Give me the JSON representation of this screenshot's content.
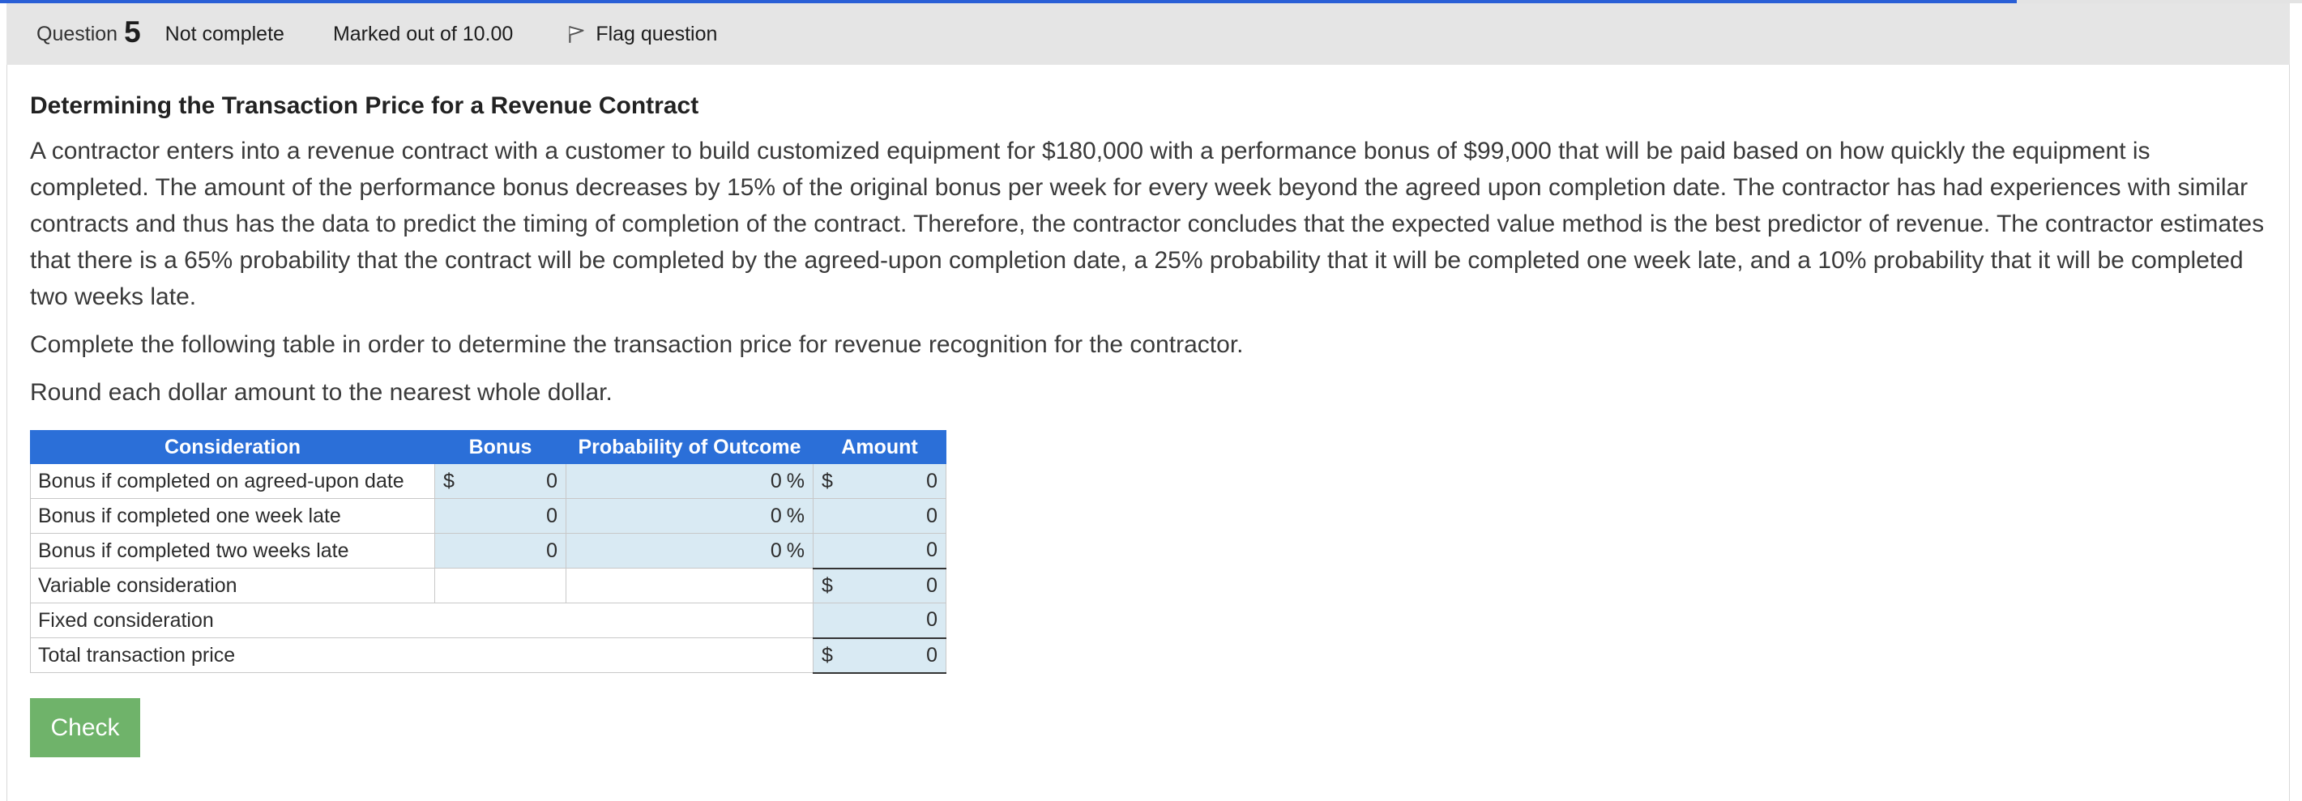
{
  "progress": {
    "fraction": 0.876,
    "accent": "#2a5fd6"
  },
  "header": {
    "question_label": "Question",
    "question_number": "5",
    "status": "Not complete",
    "marks": "Marked out of 10.00",
    "flag_label": "Flag question",
    "flag_icon": "flag-icon"
  },
  "content": {
    "title": "Determining the Transaction Price for a Revenue Contract",
    "paragraph": "A contractor enters into a revenue contract with a customer to build customized equipment for $180,000 with a performance bonus of $99,000 that will be paid based on how quickly the equipment is completed. The amount of the performance bonus decreases by 15% of the original bonus per week for every week beyond the agreed upon completion date. The contractor has had experiences with similar contracts and thus has the data to predict the timing of completion of the contract. Therefore, the contractor concludes that the expected value method is the best predictor of revenue. The contractor estimates that there is a 65% probability that the contract will be completed by the agreed-upon completion date, a 25% probability that it will be completed one week late, and a 10% probability that it will be completed two weeks late.",
    "instruction": "Complete the following table in order to determine the transaction price for revenue recognition for the contractor.",
    "rounding": "Round each dollar amount to the nearest whole dollar."
  },
  "table": {
    "headers": [
      "Consideration",
      "Bonus",
      "Probability of Outcome",
      "Amount"
    ],
    "currency": "$",
    "percent": "%",
    "rows": [
      {
        "label": "Bonus if completed on agreed-upon date",
        "bonus": "0",
        "probability": "0",
        "amount": "0"
      },
      {
        "label": "Bonus if completed one week late",
        "bonus": "0",
        "probability": "0",
        "amount": "0"
      },
      {
        "label": "Bonus if completed two weeks late",
        "bonus": "0",
        "probability": "0",
        "amount": "0"
      }
    ],
    "variable": {
      "label": "Variable consideration",
      "amount": "0"
    },
    "fixed": {
      "label": "Fixed consideration",
      "amount": "0"
    },
    "total": {
      "label": "Total transaction price",
      "amount": "0"
    }
  },
  "check_button": "Check",
  "colors": {
    "header_bg": "#e5e5e5",
    "table_header": "#2b6fd8",
    "input_bg": "#d9eaf3",
    "check_bg": "#6fb36a"
  }
}
